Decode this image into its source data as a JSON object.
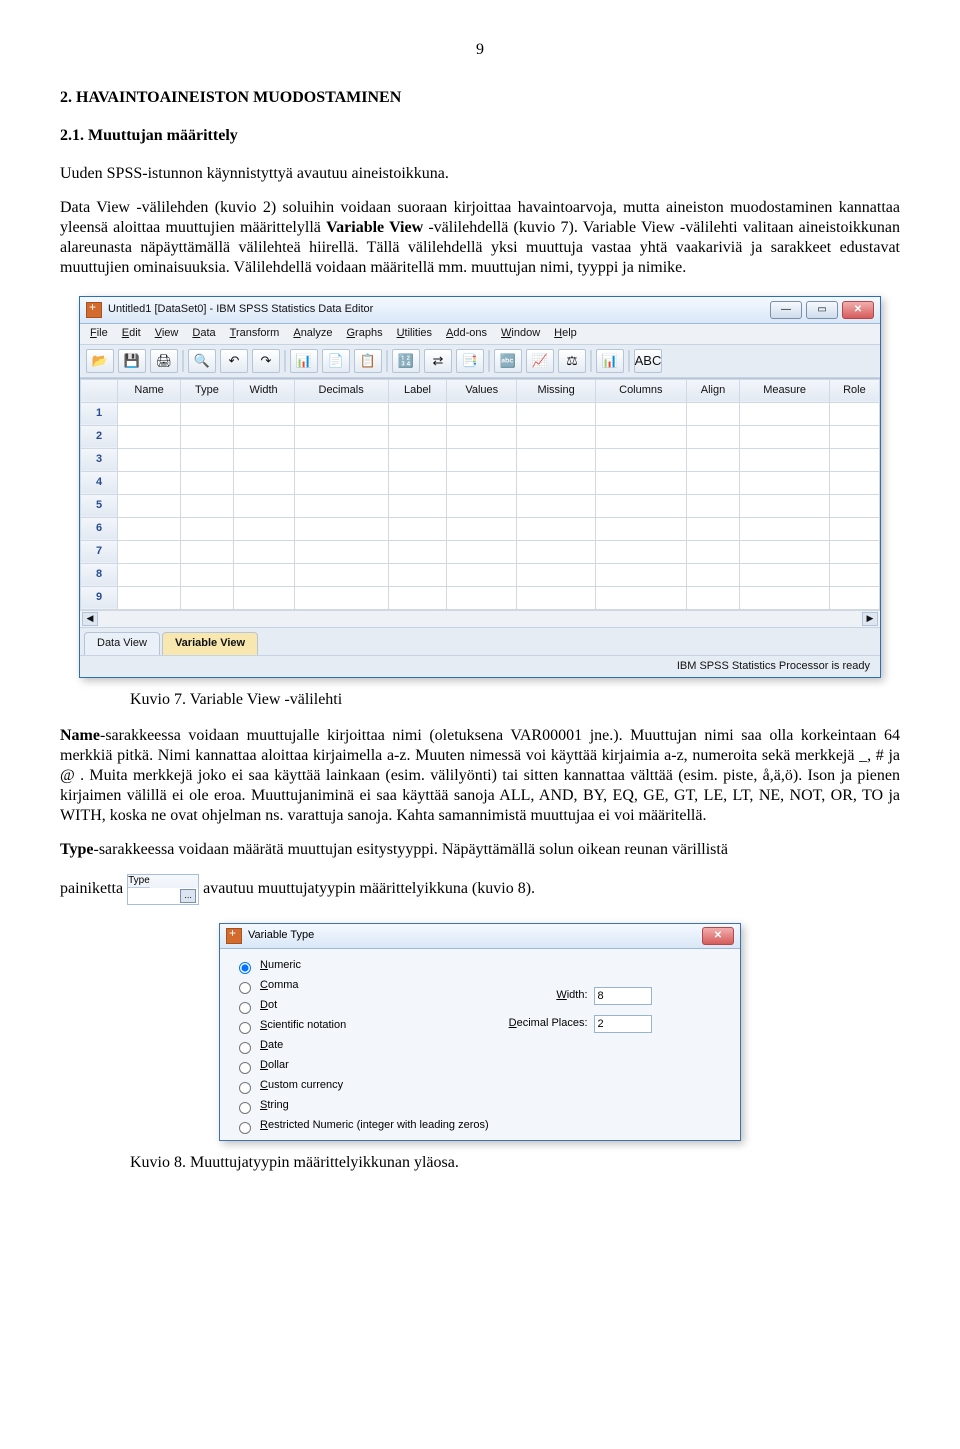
{
  "page_number": "9",
  "h2": "2. HAVAINTOAINEISTON MUODOSTAMINEN",
  "h3": "2.1. Muuttujan määrittely",
  "p1": "Uuden SPSS-istunnon käynnistyttyä avautuu aineistoikkuna.",
  "p2a": "Data View -välilehden (kuvio 2) soluihin voidaan suoraan kirjoittaa havaintoarvoja, mutta aineiston muodostaminen kannattaa yleensä aloittaa muuttujien määrittelyllä ",
  "p2b": "Variable View",
  "p2c": " -välilehdellä (kuvio 7). Variable View -välilehti valitaan aineistoikkunan alareunasta näpäyttämällä välilehteä hiirellä. Tällä välilehdellä yksi muuttuja vastaa yhtä vaakariviä ja sarakkeet edustavat muuttujien ominaisuuksia. Välilehdellä voidaan määritellä mm. muuttujan nimi, tyyppi ja nimike.",
  "caption1": "Kuvio 7.  Variable View -välilehti",
  "p3a": "Name",
  "p3b": "-sarakkeessa voidaan muuttujalle kirjoittaa nimi (oletuksena VAR00001 jne.). Muuttujan nimi saa olla korkeintaan 64 merkkiä pitkä. Nimi kannattaa aloittaa kirjaimella a-z. Muuten nimessä voi käyttää kirjaimia a-z, numeroita sekä merkkejä _, # ja @ . Muita merkkejä joko ei saa käyttää lainkaan (esim. välilyönti) tai sitten kannattaa välttää (esim. piste, å,ä,ö). Ison ja pienen kirjaimen välillä ei ole eroa. Muuttujaniminä ei saa käyttää sanoja  ALL, AND, BY, EQ, GE, GT, LE, LT, NE, NOT, OR, TO ja WITH, koska ne ovat ohjelman ns. varattuja sanoja. Kahta samannimistä muuttujaa ei voi määritellä.",
  "p4a": "Type",
  "p4b": "-sarakkeessa voidaan määrätä muuttujan esitystyyppi. Näpäyttämällä solun oikean reunan värillistä",
  "p5a": "painiketta ",
  "p5b": " avautuu muuttujatyypin määrittelyikkuna (kuvio 8).",
  "caption2": "Kuvio 8. Muuttujatyypin määrittelyikkunan yläosa.",
  "spss": {
    "title": "Untitled1 [DataSet0] - IBM SPSS Statistics Data Editor",
    "menus": [
      "File",
      "Edit",
      "View",
      "Data",
      "Transform",
      "Analyze",
      "Graphs",
      "Utilities",
      "Add-ons",
      "Window",
      "Help"
    ],
    "columns": [
      "Name",
      "Type",
      "Width",
      "Decimals",
      "Label",
      "Values",
      "Missing",
      "Columns",
      "Align",
      "Measure",
      "Role"
    ],
    "rows": [
      "1",
      "2",
      "3",
      "4",
      "5",
      "6",
      "7",
      "8",
      "9"
    ],
    "tabs": {
      "data": "Data View",
      "var": "Variable View"
    },
    "status": "IBM SPSS Statistics Processor is ready",
    "toolbar_icons": [
      "📂",
      "💾",
      "🖨",
      "",
      "🔍",
      "↶",
      "↷",
      "",
      "📊",
      "📄",
      "📋",
      "",
      "🔢",
      "⇄",
      "📑",
      "",
      "🔤",
      "📈",
      "⚖",
      "",
      "📊",
      "",
      "ABC"
    ]
  },
  "type_inline": {
    "hdr": "Type",
    "dots": "..."
  },
  "dialog": {
    "title": "Variable Type",
    "radios": [
      "Numeric",
      "Comma",
      "Dot",
      "Scientific notation",
      "Date",
      "Dollar",
      "Custom currency",
      "String",
      "Restricted Numeric (integer with leading zeros)"
    ],
    "width_label": "Width:",
    "width_value": "8",
    "dec_label": "Decimal Places:",
    "dec_value": "2"
  }
}
